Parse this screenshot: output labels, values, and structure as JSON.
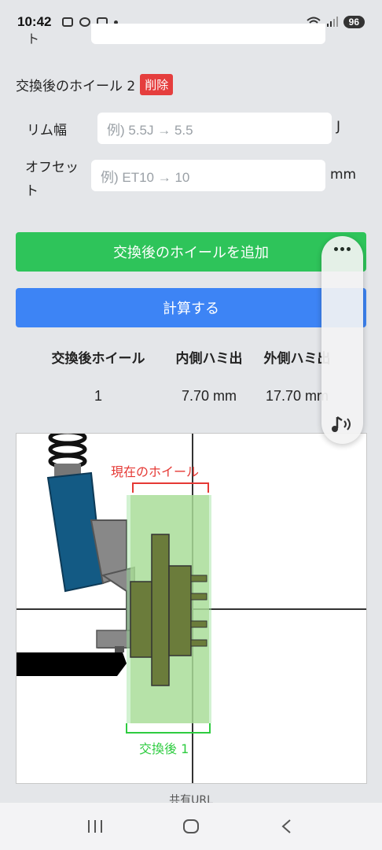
{
  "status_bar": {
    "time": "10:42",
    "battery": "96"
  },
  "wheel2": {
    "title": "交換後のホイール 2",
    "delete_label": "削除",
    "rim_label": "リム幅",
    "rim_placeholder": "例) 5.5J → 5.5",
    "rim_unit": "J",
    "offset_label_1": "オフセッ",
    "offset_label_2": "ト",
    "offset_placeholder": "例) ET10 → 10",
    "offset_unit": "mm"
  },
  "actions": {
    "add_wheel_label": "交換後のホイールを追加",
    "calculate_label": "計算する"
  },
  "results": {
    "headers": [
      "交換後ホイール",
      "内側ハミ出",
      "外側ハミ出"
    ],
    "rows": [
      [
        "1",
        "7.70 mm",
        "17.70 mm"
      ]
    ]
  },
  "diagram": {
    "current_wheel_label": "現在のホイール",
    "after_wheel_label": "交換後 1"
  },
  "share_label": "共有URL",
  "prev_label_tail": "ト"
}
